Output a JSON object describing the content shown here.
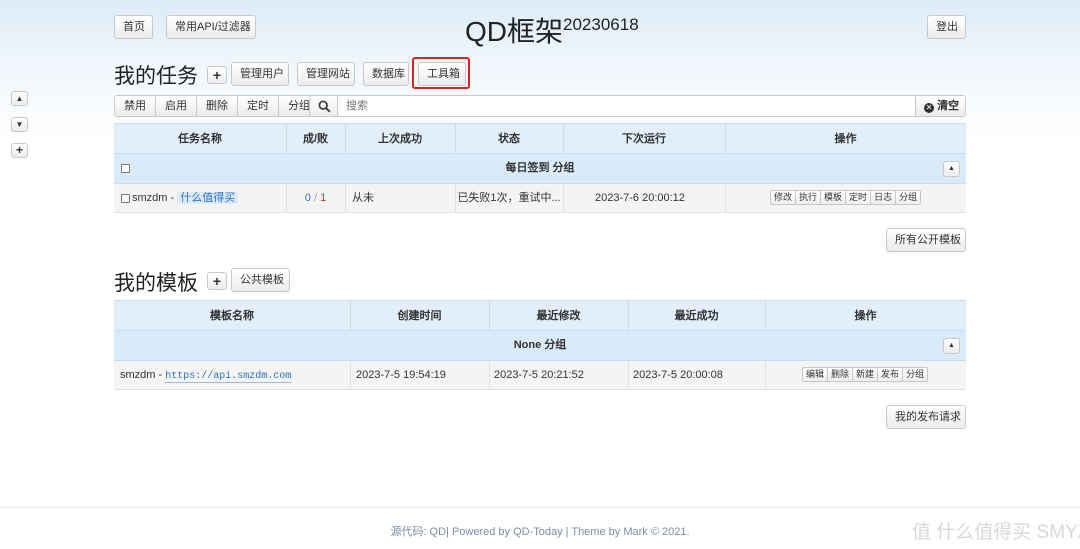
{
  "nav": {
    "home": "首页",
    "api_filter": "常用API/过滤器",
    "logout": "登出"
  },
  "header": {
    "title": "QD框架",
    "version": "20230618"
  },
  "side": {
    "up": "▲",
    "down": "▼",
    "add": "+"
  },
  "tasks": {
    "heading": "我的任务",
    "add_symbol": "+",
    "tabs": [
      "管理用户",
      "管理网站",
      "数据库",
      "工具箱"
    ],
    "bulk": [
      "禁用",
      "启用",
      "删除",
      "定时",
      "分组"
    ],
    "search_placeholder": "搜索",
    "clear_label": "清空",
    "columns": [
      "任务名称",
      "成/败",
      "上次成功",
      "状态",
      "下次运行",
      "操作"
    ],
    "group_label": "每日签到 分组",
    "collapse_symbol": "▲",
    "rows": [
      {
        "name": "smzdm",
        "site": "什么值得买",
        "success": "0",
        "fail": "1",
        "last_success": "从未",
        "status": "已失败1次，重试中...",
        "next_run": "2023-7-6 20:00:12",
        "ops": [
          "修改",
          "执行",
          "模板",
          "定时",
          "日志",
          "分组"
        ]
      }
    ],
    "public_templates": "所有公开模板"
  },
  "templates": {
    "heading": "我的模板",
    "add_symbol": "+",
    "public": "公共模板",
    "columns": [
      "模板名称",
      "创建时间",
      "最近修改",
      "最近成功",
      "操作"
    ],
    "group_label": "None 分组",
    "collapse_symbol": "▲",
    "rows": [
      {
        "name": "smzdm",
        "url": "https://api.smzdm.com",
        "created": "2023-7-5 19:54:19",
        "modified": "2023-7-5 20:21:52",
        "last_success": "2023-7-5 20:00:08",
        "ops": [
          "编辑",
          "删除",
          "新建",
          "发布",
          "分组"
        ]
      }
    ],
    "publish_requests": "我的发布请求"
  },
  "footer": "源代码: QD| Powered by QD-Today | Theme by Mark © 2021.",
  "watermark": "值 什么值得买 SMYZ.NET",
  "colors": {
    "highlight": "#e02020",
    "link": "#2a73c0",
    "header_bg": "#e2eef9"
  }
}
